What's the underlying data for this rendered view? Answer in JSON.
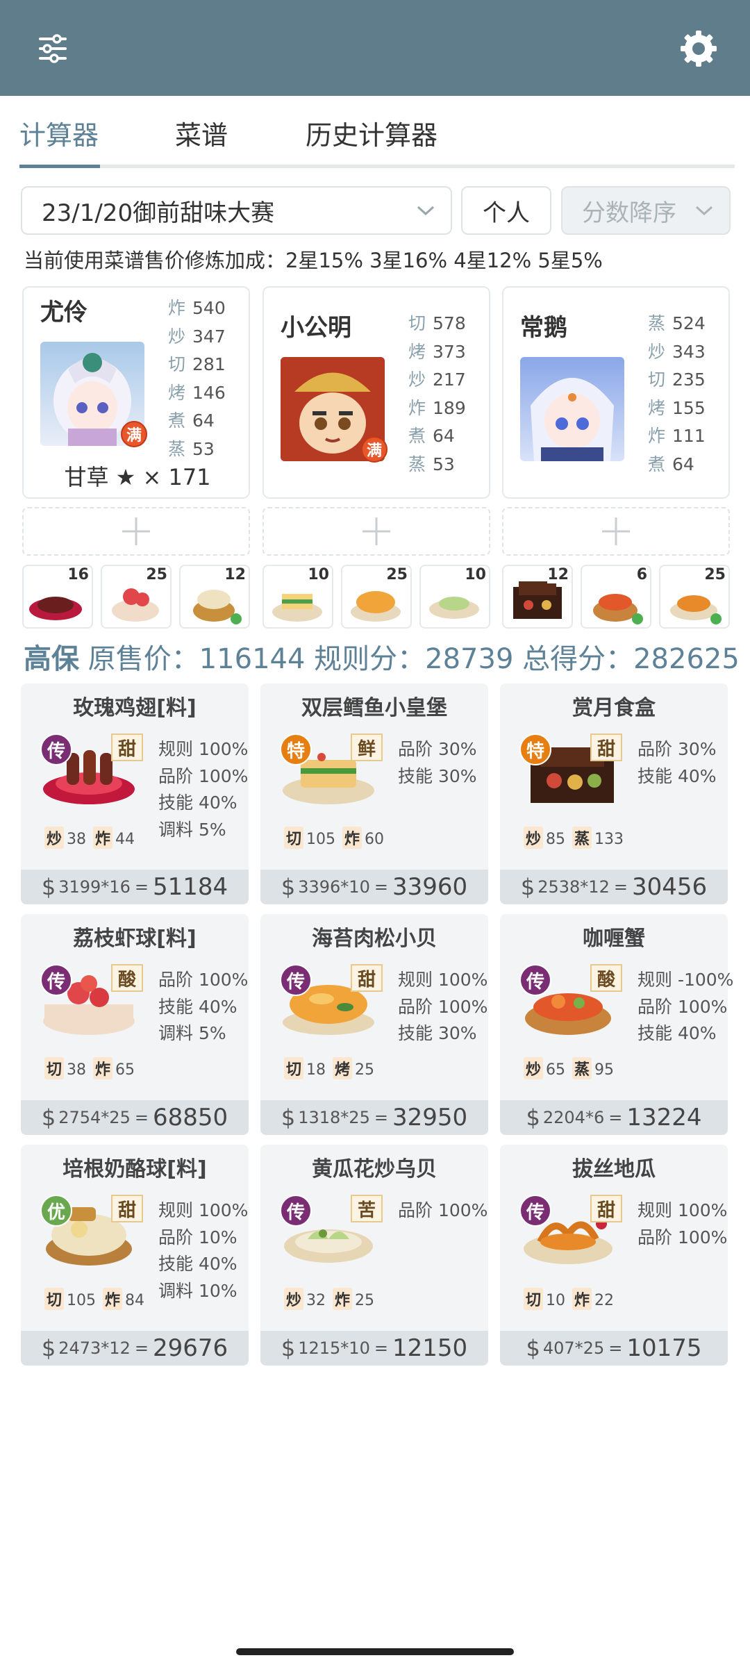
{
  "appbar": {
    "filter_icon": "sliders-icon",
    "settings_icon": "gear-icon"
  },
  "tabs": [
    {
      "label": "计算器",
      "active": true
    },
    {
      "label": "菜谱",
      "active": false
    },
    {
      "label": "历史计算器",
      "active": false
    }
  ],
  "controls": {
    "contest": "23/1/20御前甜味大赛",
    "mode": "个人",
    "sort": "分数降序"
  },
  "bonus_text": "当前使用菜谱售价修炼加成：2星15% 3星16% 4星12% 5星5%",
  "chefs": [
    {
      "name": "尤伶",
      "badge": "满",
      "stats": [
        {
          "k": "炸",
          "v": "540"
        },
        {
          "k": "炒",
          "v": "347"
        },
        {
          "k": "切",
          "v": "281"
        },
        {
          "k": "烤",
          "v": "146"
        },
        {
          "k": "煮",
          "v": "64"
        },
        {
          "k": "蒸",
          "v": "53"
        }
      ],
      "extra": "甘草 ★ × 171"
    },
    {
      "name": "小公明",
      "badge": "满",
      "stats": [
        {
          "k": "切",
          "v": "578"
        },
        {
          "k": "烤",
          "v": "373"
        },
        {
          "k": "炒",
          "v": "217"
        },
        {
          "k": "炸",
          "v": "189"
        },
        {
          "k": "煮",
          "v": "64"
        },
        {
          "k": "蒸",
          "v": "53"
        }
      ]
    },
    {
      "name": "常鹅",
      "stats": [
        {
          "k": "蒸",
          "v": "524"
        },
        {
          "k": "炒",
          "v": "343"
        },
        {
          "k": "切",
          "v": "235"
        },
        {
          "k": "烤",
          "v": "155"
        },
        {
          "k": "炸",
          "v": "111"
        },
        {
          "k": "煮",
          "v": "64"
        }
      ]
    }
  ],
  "recipe_counts": [
    "16",
    "25",
    "12",
    "10",
    "25",
    "10",
    "12",
    "6",
    "25"
  ],
  "summary": {
    "level": "高保",
    "orig_label": "原售价：",
    "orig": "116144",
    "rule_label": "规则分：",
    "rule": "28739",
    "total_label": "总得分：",
    "total": "282625"
  },
  "dishes": [
    {
      "name": "玫瑰鸡翅[料]",
      "rarity": "传",
      "flavor": "甜",
      "bonuses": [
        "规则 100%",
        "品阶 100%",
        "技能 40%",
        "调料 5%"
      ],
      "skills": [
        {
          "k": "炒",
          "v": "38"
        },
        {
          "k": "炸",
          "v": "44"
        }
      ],
      "price": "3199",
      "mult": "*16",
      "total": "51184"
    },
    {
      "name": "双层鳕鱼小皇堡",
      "rarity": "特",
      "flavor": "鲜",
      "bonuses": [
        "品阶 30%",
        "技能 30%"
      ],
      "skills": [
        {
          "k": "切",
          "v": "105"
        },
        {
          "k": "炸",
          "v": "60"
        }
      ],
      "price": "3396",
      "mult": "*10",
      "total": "33960"
    },
    {
      "name": "赏月食盒",
      "rarity": "特",
      "flavor": "甜",
      "bonuses": [
        "品阶 30%",
        "技能 40%"
      ],
      "skills": [
        {
          "k": "炒",
          "v": "85"
        },
        {
          "k": "蒸",
          "v": "133"
        }
      ],
      "price": "2538",
      "mult": "*12",
      "total": "30456"
    },
    {
      "name": "荔枝虾球[料]",
      "rarity": "传",
      "flavor": "酸",
      "bonuses": [
        "品阶 100%",
        "技能 40%",
        "调料 5%"
      ],
      "skills": [
        {
          "k": "切",
          "v": "38"
        },
        {
          "k": "炸",
          "v": "65"
        }
      ],
      "price": "2754",
      "mult": "*25",
      "total": "68850"
    },
    {
      "name": "海苔肉松小贝",
      "rarity": "传",
      "flavor": "甜",
      "bonuses": [
        "规则 100%",
        "品阶 100%",
        "技能 30%"
      ],
      "skills": [
        {
          "k": "切",
          "v": "18"
        },
        {
          "k": "烤",
          "v": "25"
        }
      ],
      "price": "1318",
      "mult": "*25",
      "total": "32950"
    },
    {
      "name": "咖喱蟹",
      "rarity": "传",
      "flavor": "酸",
      "bonuses": [
        "规则 -100%",
        "品阶 100%",
        "技能 40%"
      ],
      "skills": [
        {
          "k": "炒",
          "v": "65"
        },
        {
          "k": "蒸",
          "v": "95"
        }
      ],
      "price": "2204",
      "mult": "*6",
      "total": "13224"
    },
    {
      "name": "培根奶酪球[料]",
      "rarity": "优",
      "flavor": "甜",
      "bonuses": [
        "规则 100%",
        "品阶 10%",
        "技能 40%",
        "调料 10%"
      ],
      "skills": [
        {
          "k": "切",
          "v": "105"
        },
        {
          "k": "炸",
          "v": "84"
        }
      ],
      "price": "2473",
      "mult": "*12",
      "total": "29676"
    },
    {
      "name": "黄瓜花炒乌贝",
      "rarity": "传",
      "flavor": "苦",
      "bonuses": [
        "品阶 100%"
      ],
      "skills": [
        {
          "k": "炒",
          "v": "32"
        },
        {
          "k": "炸",
          "v": "25"
        }
      ],
      "price": "1215",
      "mult": "*10",
      "total": "12150"
    },
    {
      "name": "拔丝地瓜",
      "rarity": "传",
      "flavor": "甜",
      "bonuses": [
        "规则 100%",
        "品阶 100%"
      ],
      "skills": [
        {
          "k": "切",
          "v": "10"
        },
        {
          "k": "炸",
          "v": "22"
        }
      ],
      "price": "407",
      "mult": "*25",
      "total": "10175"
    }
  ],
  "colors": {
    "appbar": "#607d8b",
    "accent": "#5d8196",
    "rarity_chuan": "#7b2d74",
    "rarity_te": "#e67e12",
    "rarity_you": "#6aa84f"
  }
}
